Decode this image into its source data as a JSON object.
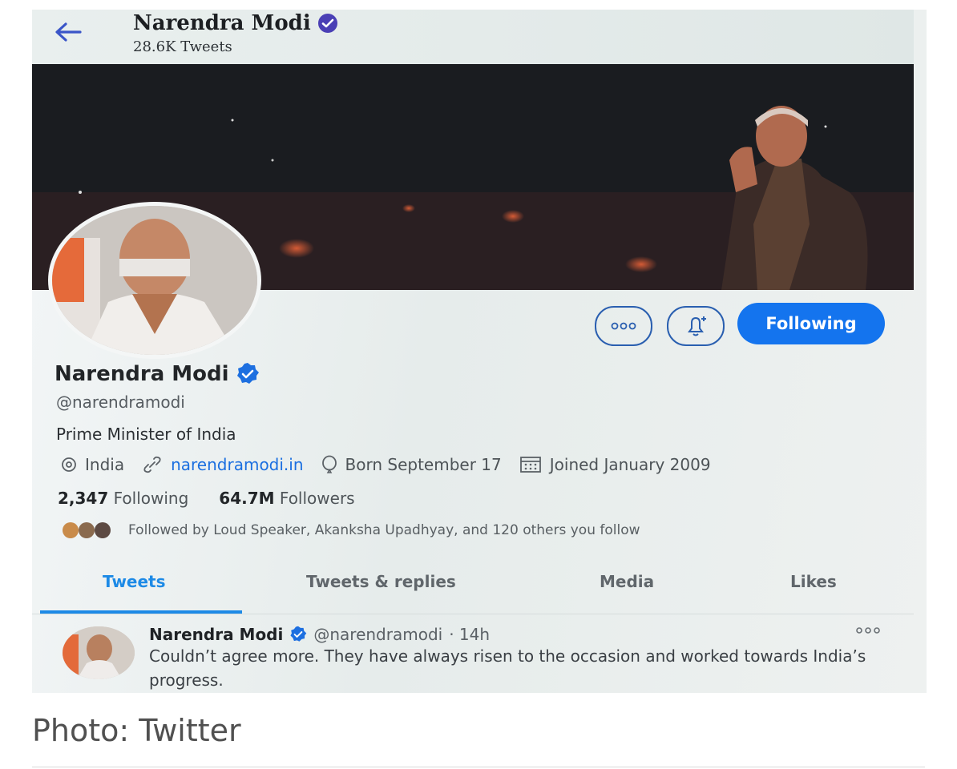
{
  "header": {
    "name": "Narendra Modi",
    "tweet_count": "28.6K Tweets"
  },
  "profile": {
    "name": "Narendra Modi",
    "handle": "@narendramodi",
    "bio": "Prime Minister of India",
    "location": "India",
    "website": "narendramodi.in",
    "born": "Born September 17",
    "joined": "Joined January 2009",
    "following_count": "2,347",
    "following_label": "Following",
    "followers_count": "64.7M",
    "followers_label": "Followers",
    "followed_by": "Followed by Loud Speaker, Akanksha Upadhyay, and 120 others you follow"
  },
  "actions": {
    "following_button": "Following"
  },
  "tabs": [
    {
      "label": "Tweets"
    },
    {
      "label": "Tweets & replies"
    },
    {
      "label": "Media"
    },
    {
      "label": "Likes"
    }
  ],
  "tweet": {
    "name": "Narendra Modi",
    "handle": "@narendramodi",
    "time": "· 14h",
    "text": "Couldn’t agree more. They have always risen to the occasion and worked towards India’s progress."
  },
  "caption": "Photo: Twitter",
  "colors": {
    "accent": "#1474ee",
    "verified": "#1d6fe0",
    "banner": "#1d1f24"
  },
  "icons": [
    "back-arrow-icon",
    "verified-badge-icon",
    "more-icon",
    "bell-plus-icon",
    "location-icon",
    "link-icon",
    "birthday-balloon-icon",
    "calendar-icon"
  ]
}
